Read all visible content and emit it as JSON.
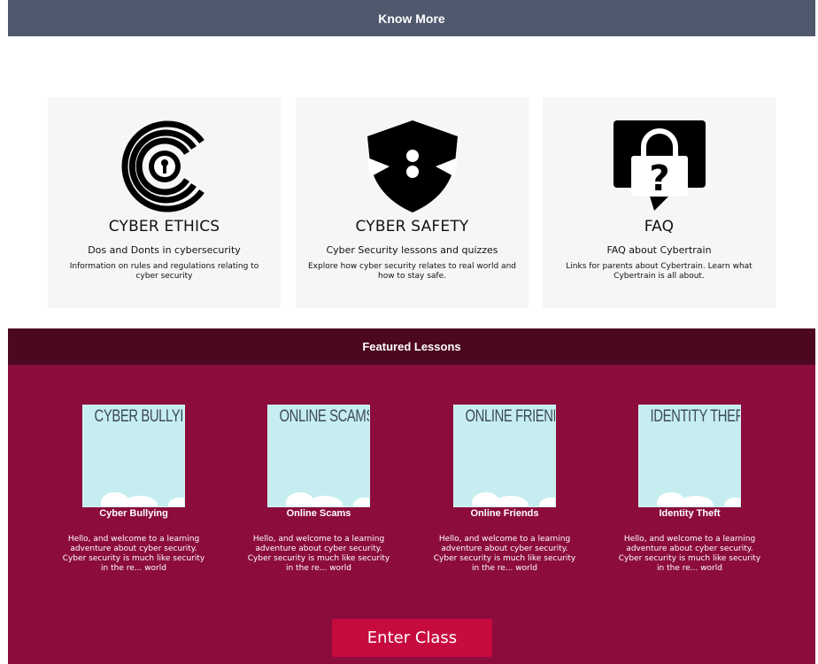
{
  "know_more": {
    "title": "Know More"
  },
  "cards": [
    {
      "icon": "lock-circle-icon",
      "title": "CYBER ETHICS",
      "subtitle": "Dos and Donts in cybersecurity",
      "description": "Information on rules and regulations relating to cyber security"
    },
    {
      "icon": "shield-icon",
      "title": "CYBER SAFETY",
      "subtitle": "Cyber Security lessons and quizzes",
      "description": "Explore how cyber security relates to real world and how to stay safe."
    },
    {
      "icon": "question-lock-icon",
      "title": "FAQ",
      "subtitle": "FAQ about Cybertrain",
      "description": "Links for parents about Cybertrain. Learn what Cybertrain is all about."
    }
  ],
  "featured": {
    "title": "Featured Lessons",
    "lessons": [
      {
        "thumb_text": "CYBER BULLYING",
        "name": "Cyber Bullying",
        "description": "Hello, and welcome to a learning adventure about cyber security. Cyber security is much like security in the re... world"
      },
      {
        "thumb_text": "ONLINE SCAMS",
        "name": "Online Scams",
        "description": "Hello, and welcome to a learning adventure about cyber security. Cyber security is much like security in the re... world"
      },
      {
        "thumb_text": "ONLINE FRIENDS",
        "name": "Online Friends",
        "description": "Hello, and welcome to a learning adventure about cyber security. Cyber security is much like security in the re... world"
      },
      {
        "thumb_text": "IDENTITY THEFT",
        "name": "Identity Theft",
        "description": "Hello, and welcome to a learning adventure about cyber security. Cyber security is much like security in the re... world"
      }
    ],
    "button_label": "Enter Class"
  }
}
